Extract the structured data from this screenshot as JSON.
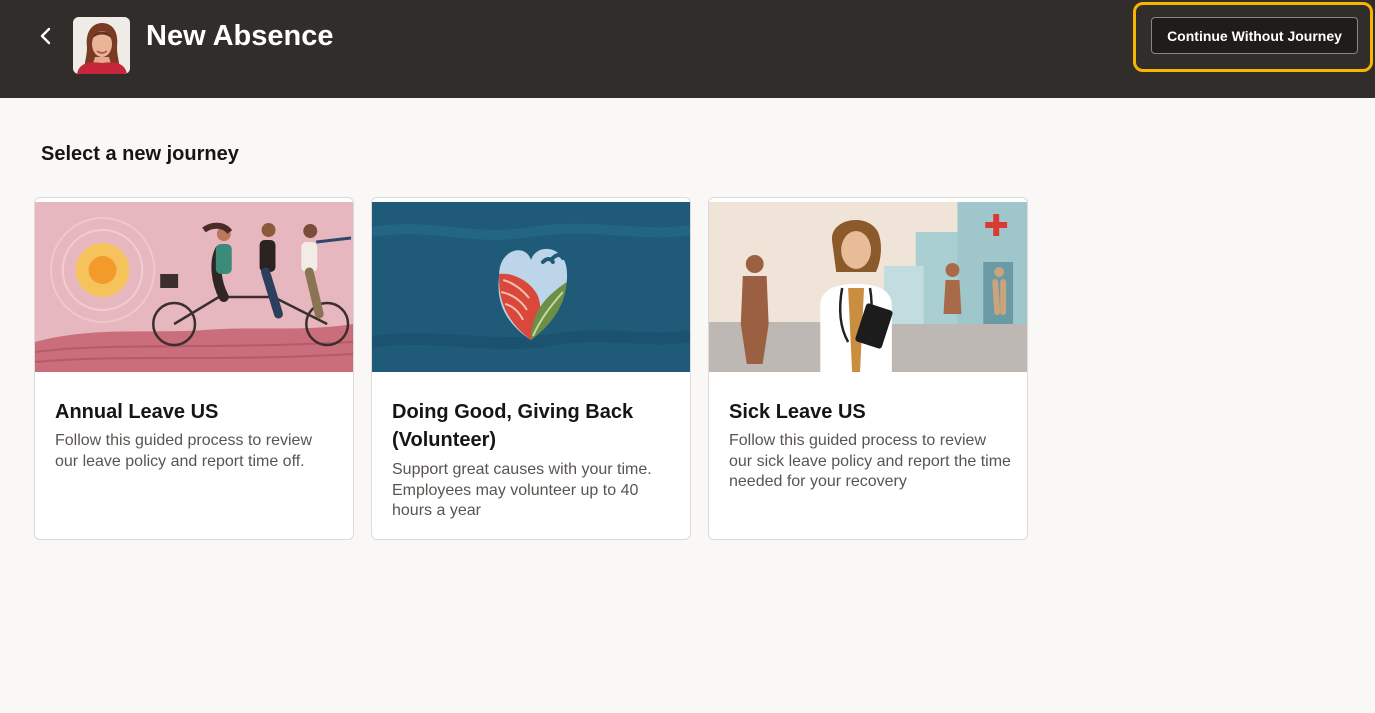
{
  "header": {
    "title": "New Absence",
    "continue_label": "Continue Without Journey"
  },
  "main": {
    "section_title": "Select a new journey",
    "cards": [
      {
        "title": "Annual Leave US",
        "description": "Follow this guided process to review our leave policy and report time off."
      },
      {
        "title": "Doing Good, Giving Back (Volunteer)",
        "description": "Support great causes with your time. Employees may volunteer up to 40 hours a year"
      },
      {
        "title": "Sick Leave US",
        "description": "Follow this guided process to review our sick leave policy and report the time needed for your recovery"
      }
    ]
  },
  "colors": {
    "header_bg": "#312d2a",
    "highlight": "#f7b500",
    "page_bg": "#f9f8f6"
  }
}
